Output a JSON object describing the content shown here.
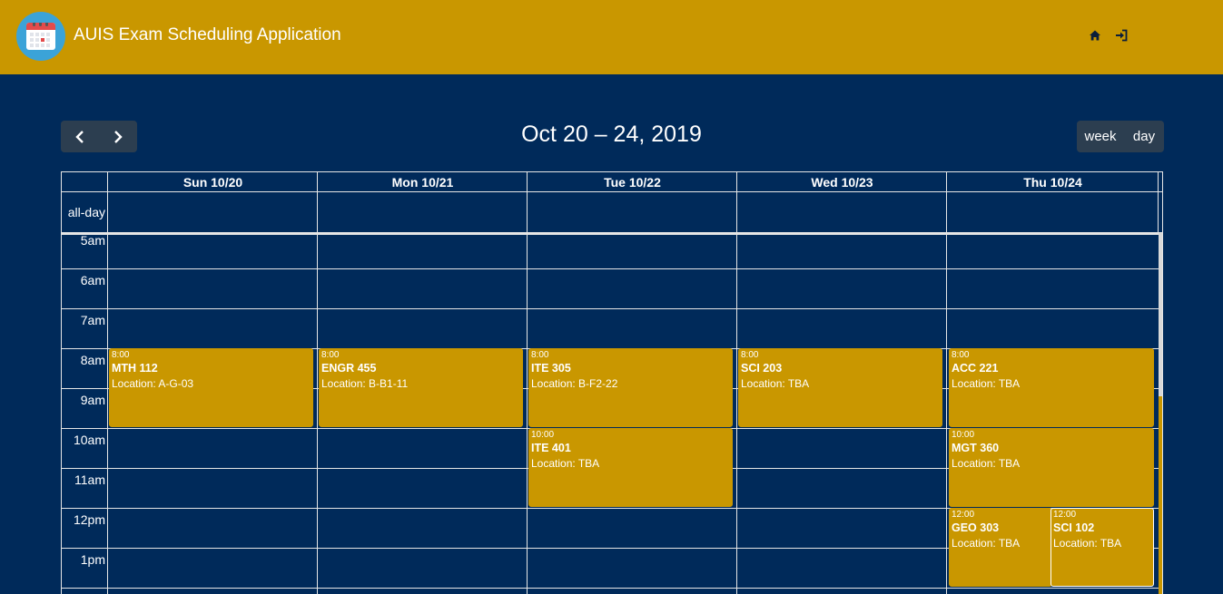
{
  "header": {
    "title": "AUIS Exam Scheduling Application",
    "logo_icon": "calendar-logo-icon",
    "nav": [
      {
        "name": "home-icon",
        "glyph": "⌂"
      },
      {
        "name": "sign-in-icon",
        "glyph": "⇥"
      }
    ],
    "colors": {
      "bar": "#c99700",
      "page": "#002a5a"
    }
  },
  "toolbar": {
    "prev_label": "‹",
    "next_label": "›",
    "range_title": "Oct 20 – 24, 2019",
    "views": [
      "week",
      "day"
    ]
  },
  "calendar": {
    "allday_label": "all-day",
    "days": [
      "Sun 10/20",
      "Mon 10/21",
      "Tue 10/22",
      "Wed 10/23",
      "Thu 10/24"
    ],
    "times": [
      "5am",
      "6am",
      "7am",
      "8am",
      "9am",
      "10am",
      "11am",
      "12pm",
      "1pm"
    ],
    "events": [
      {
        "day": 0,
        "start": "8:00",
        "title": "MTH 112",
        "location": "Location: A-G-03"
      },
      {
        "day": 1,
        "start": "8:00",
        "title": "ENGR 455",
        "location": "Location: B-B1-11"
      },
      {
        "day": 2,
        "start": "8:00",
        "title": "ITE 305",
        "location": "Location: B-F2-22"
      },
      {
        "day": 2,
        "start": "10:00",
        "title": "ITE 401",
        "location": "Location: TBA"
      },
      {
        "day": 3,
        "start": "8:00",
        "title": "SCI 203",
        "location": "Location: TBA"
      },
      {
        "day": 4,
        "start": "8:00",
        "title": "ACC 221",
        "location": "Location: TBA"
      },
      {
        "day": 4,
        "start": "10:00",
        "title": "MGT 360",
        "location": "Location: TBA"
      },
      {
        "day": 4,
        "start": "12:00",
        "title": "GEO 303",
        "location": "Location: TBA"
      },
      {
        "day": 4,
        "start": "12:00",
        "title": "SCI 102",
        "location": "Location: TBA"
      }
    ]
  }
}
